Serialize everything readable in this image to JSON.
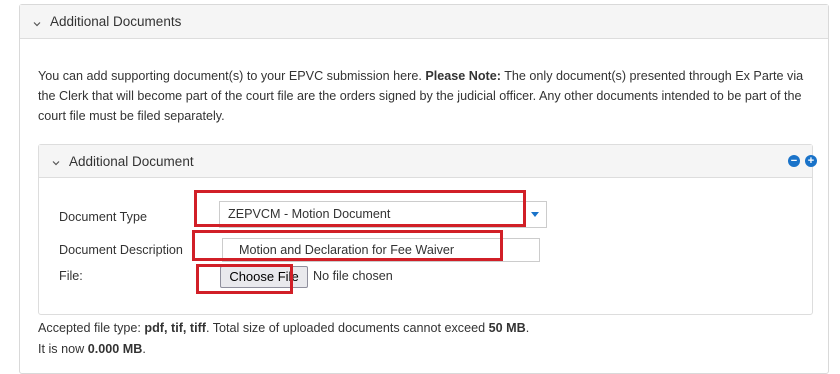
{
  "outer_panel": {
    "title": "Additional Documents"
  },
  "intro": {
    "text_before": "You can add supporting document(s) to your EPVC submission here. ",
    "note_label": "Please Note:",
    "text_after": " The only document(s) presented through Ex Parte via the Clerk that will become part of the court file are the orders signed by the judicial officer. Any other documents intended to be part of the court file must be filed separately."
  },
  "inner_panel": {
    "title": "Additional Document",
    "remove_symbol": "−",
    "add_symbol": "+"
  },
  "form": {
    "document_type_label": "Document Type",
    "document_type_value": "ZEPVCM - Motion Document",
    "document_description_label": "Document Description",
    "document_description_value": "Motion and Declaration for Fee Waiver",
    "file_label": "File:",
    "choose_file_label": "Choose File",
    "file_status": "No file chosen"
  },
  "footer": {
    "accepted_prefix": "Accepted file type: ",
    "accepted_types": "pdf, tif, tiff",
    "size_text": ". Total size of uploaded documents cannot exceed ",
    "size_limit": "50 MB",
    "size_end": ".",
    "now_prefix": "It is now ",
    "now_value": "0.000 MB",
    "now_end": "."
  },
  "colors": {
    "highlight": "#d11f27",
    "accent": "#1a73c9",
    "header_bg": "#f5f5f5"
  }
}
